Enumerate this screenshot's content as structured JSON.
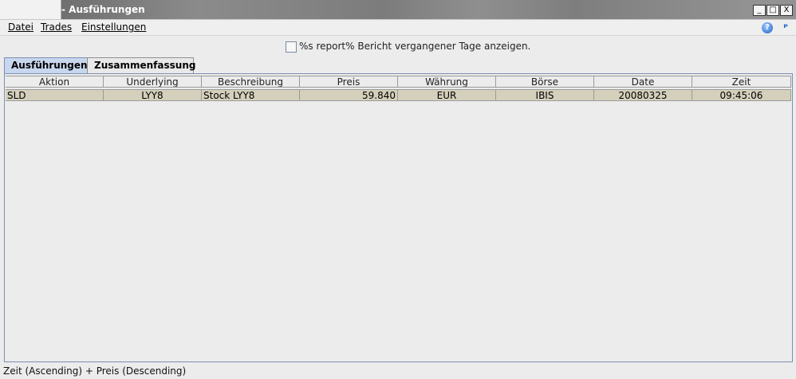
{
  "window": {
    "title": "- Ausführungen"
  },
  "window_buttons": {
    "minimize": "_",
    "maximize": "□",
    "close": "X"
  },
  "menu": {
    "items": [
      "Datei",
      "Trades",
      "Einstellungen"
    ]
  },
  "toolbar": {
    "help_symbol": "?",
    "pin_symbol": "ᴾ"
  },
  "report": {
    "label": "%s report% Bericht vergangener Tage anzeigen."
  },
  "tabs": [
    {
      "label": "Ausführungen",
      "active": true
    },
    {
      "label": "Zusammenfassung",
      "active": false
    }
  ],
  "table": {
    "columns": [
      "Aktion",
      "Underlying",
      "Beschreibung",
      "Preis",
      "Währung",
      "Börse",
      "Date",
      "Zeit"
    ],
    "rows": [
      [
        "SLD",
        "LYY8",
        "Stock LYY8",
        "59.840",
        "EUR",
        "IBIS",
        "20080325",
        "09:45:06"
      ]
    ]
  },
  "status": {
    "text": "Zeit (Ascending)  +  Preis (Descending)"
  },
  "colors": {
    "row_bg": "#d4d0bb",
    "tab_active": "#c9d7ee",
    "frame_border": "#7a8fb3"
  }
}
